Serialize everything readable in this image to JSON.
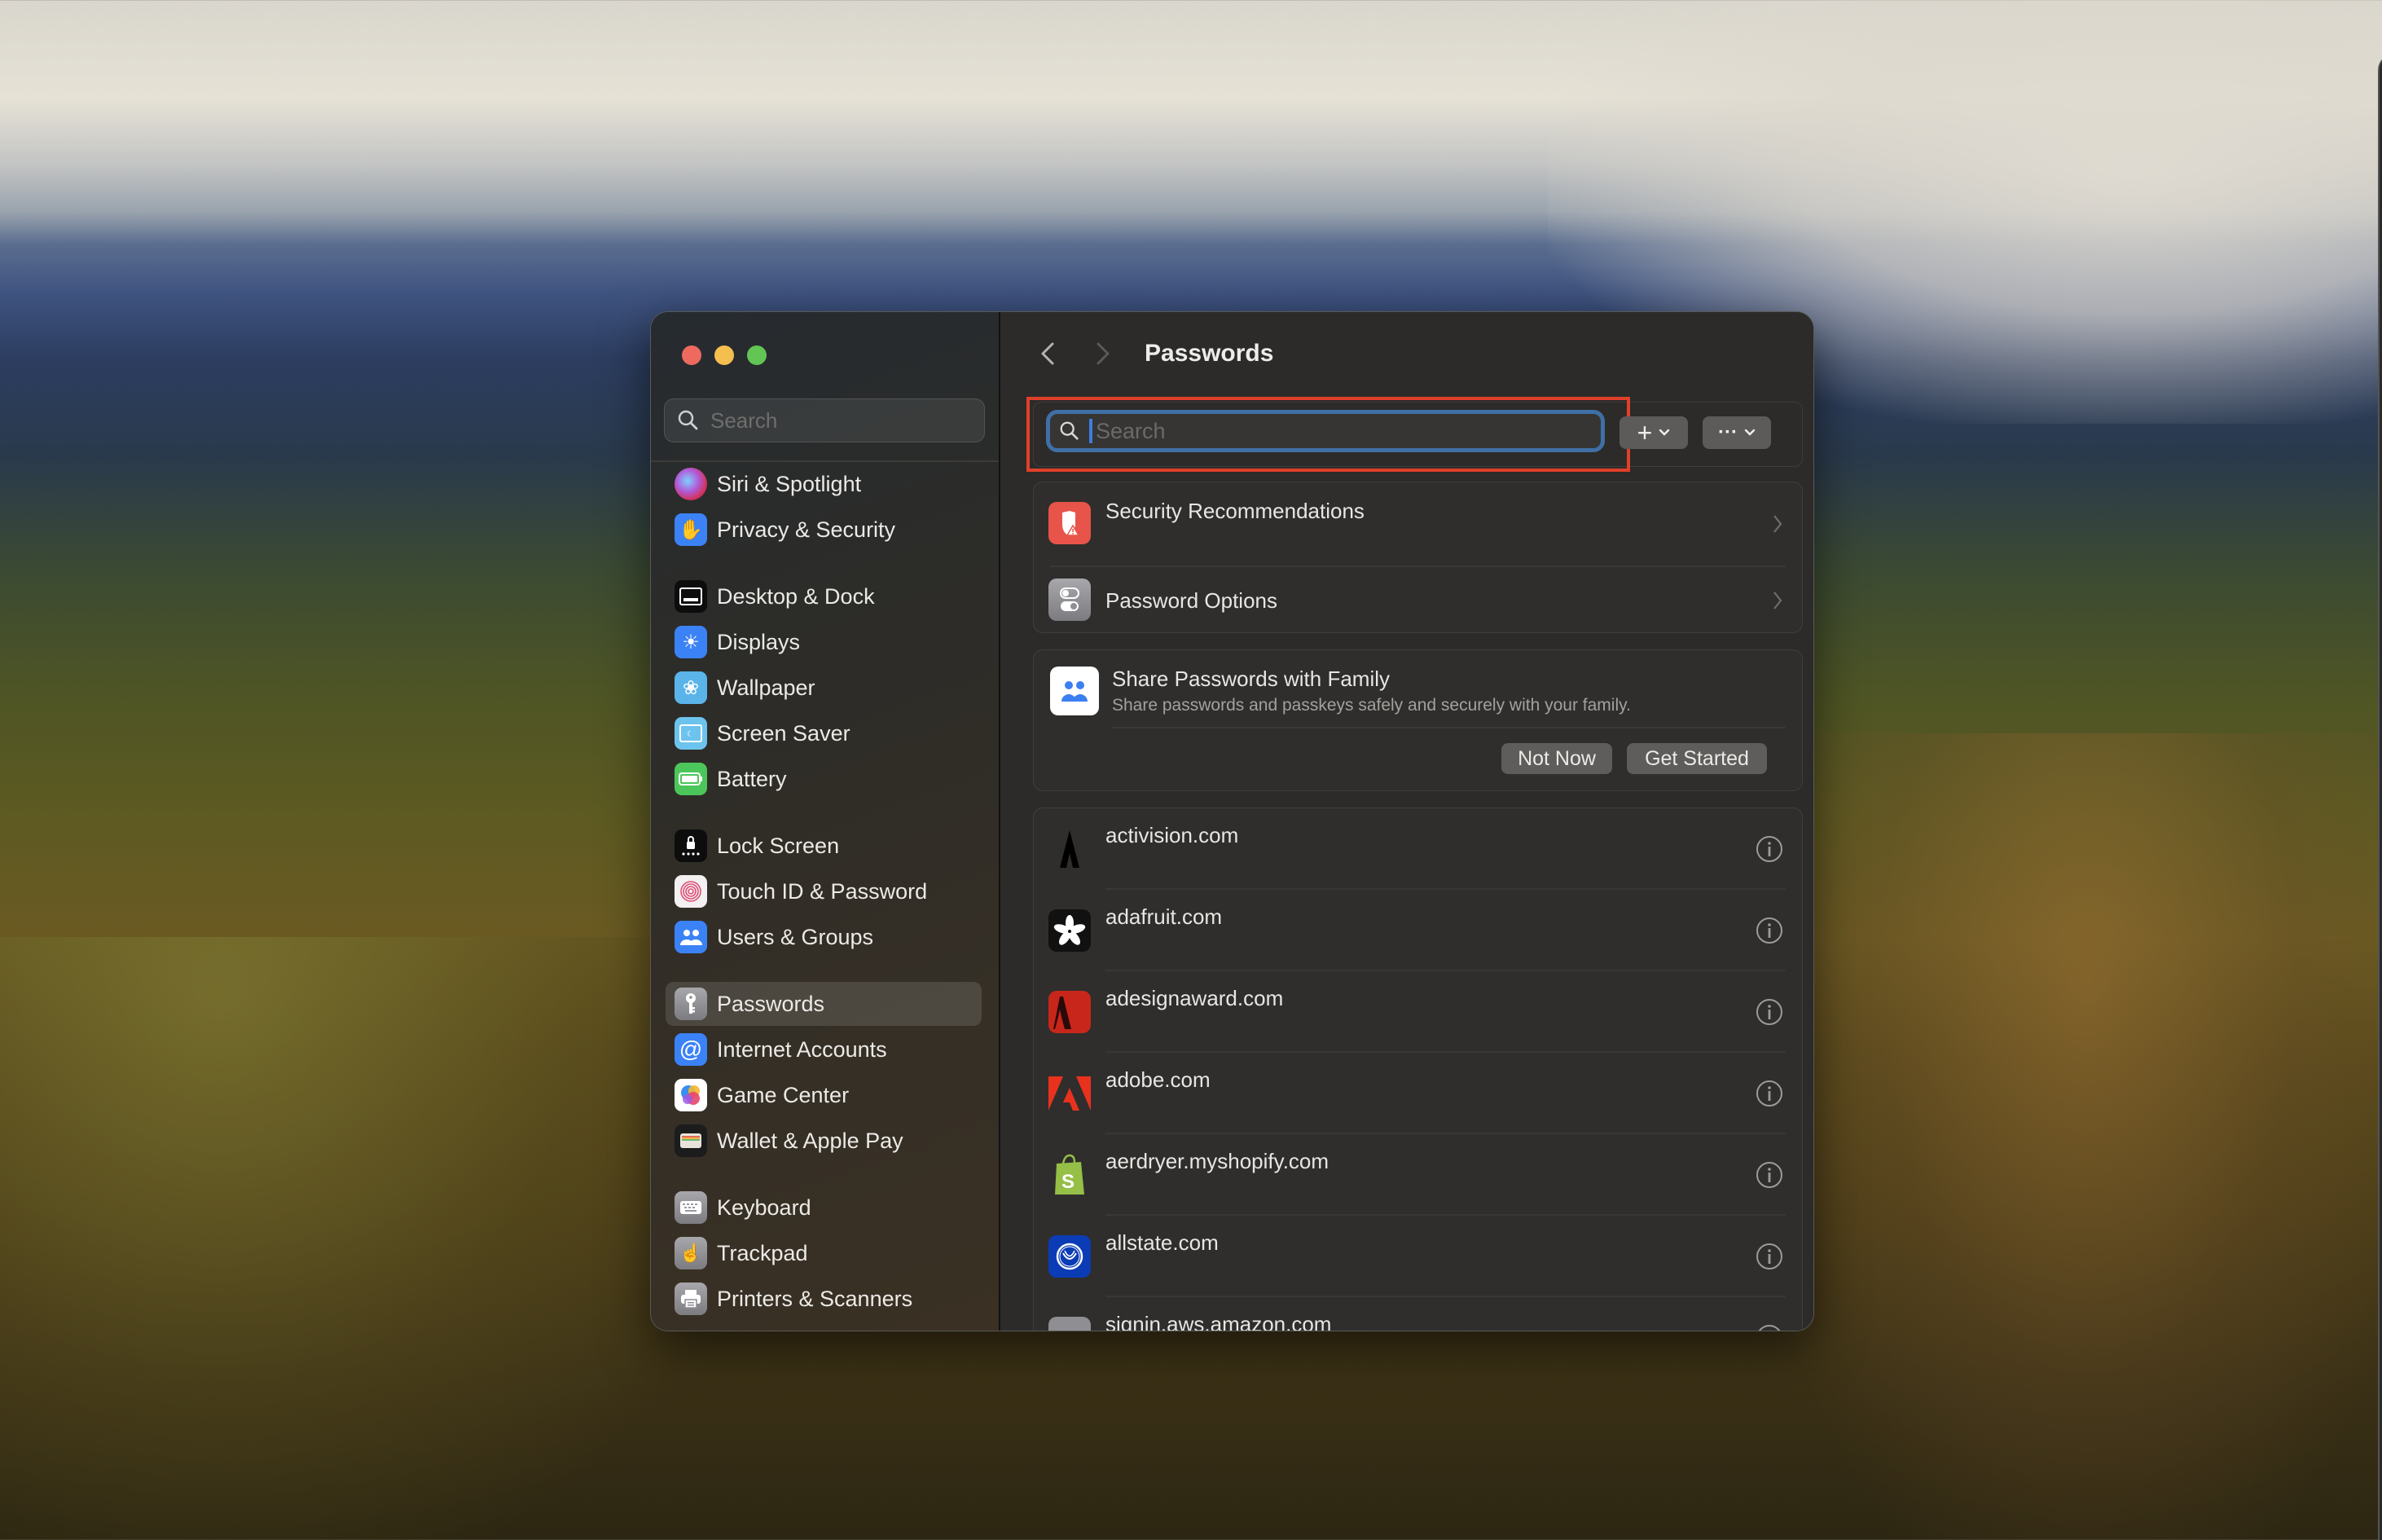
{
  "window": {
    "title": "Passwords",
    "traffic_lights": [
      "close",
      "minimize",
      "maximize"
    ]
  },
  "sidebar": {
    "search_placeholder": "Search",
    "items": [
      {
        "label": "Siri & Spotlight",
        "icon": "siri-icon",
        "color": "#8a3aa0"
      },
      {
        "label": "Privacy & Security",
        "icon": "hand-icon",
        "color": "#3b82f6"
      },
      {
        "label": "Desktop & Dock",
        "icon": "dock-icon",
        "color": "#111111"
      },
      {
        "label": "Displays",
        "icon": "sun-icon",
        "color": "#3b82f6"
      },
      {
        "label": "Wallpaper",
        "icon": "flower-icon",
        "color": "#5ab4ea"
      },
      {
        "label": "Screen Saver",
        "icon": "screensaver-icon",
        "color": "#6cc3ee"
      },
      {
        "label": "Battery",
        "icon": "battery-icon",
        "color": "#4cc65a"
      },
      {
        "label": "Lock Screen",
        "icon": "lock-icon",
        "color": "#111111"
      },
      {
        "label": "Touch ID & Password",
        "icon": "fingerprint-icon",
        "color": "#f2f0f0"
      },
      {
        "label": "Users & Groups",
        "icon": "users-icon",
        "color": "#3b82f6"
      },
      {
        "label": "Passwords",
        "icon": "key-icon",
        "color": "#8e8e93",
        "selected": true
      },
      {
        "label": "Internet Accounts",
        "icon": "at-icon",
        "color": "#3b82f6"
      },
      {
        "label": "Game Center",
        "icon": "game-center-icon",
        "color": "#ffffff"
      },
      {
        "label": "Wallet & Apple Pay",
        "icon": "wallet-icon",
        "color": "#1c1c1c"
      },
      {
        "label": "Keyboard",
        "icon": "keyboard-icon",
        "color": "#8e8e93"
      },
      {
        "label": "Trackpad",
        "icon": "trackpad-icon",
        "color": "#8e8e93"
      },
      {
        "label": "Printers & Scanners",
        "icon": "printer-icon",
        "color": "#8e8e93"
      }
    ]
  },
  "main": {
    "nav": {
      "back": "back-icon",
      "forward": "forward-icon"
    },
    "title": "Passwords",
    "search": {
      "placeholder": "Search",
      "value": ""
    },
    "toolbar": {
      "add_label": "+",
      "more_label": "···"
    },
    "settings_rows": [
      {
        "label": "Security Recommendations",
        "icon": "shield-warning-icon",
        "color": "#e8544a"
      },
      {
        "label": "Password Options",
        "icon": "toggles-icon",
        "color": "#8e8e93"
      }
    ],
    "share_card": {
      "title": "Share Passwords with Family",
      "subtitle": "Share passwords and passkeys safely and securely with your family.",
      "not_now_label": "Not Now",
      "get_started_label": "Get Started"
    },
    "accounts": [
      {
        "site": "activision.com",
        "icon": "activision-icon"
      },
      {
        "site": "adafruit.com",
        "icon": "adafruit-icon"
      },
      {
        "site": "adesignaward.com",
        "icon": "adesignaward-icon"
      },
      {
        "site": "adobe.com",
        "icon": "adobe-icon"
      },
      {
        "site": "aerdryer.myshopify.com",
        "icon": "shopify-icon"
      },
      {
        "site": "allstate.com",
        "icon": "allstate-icon"
      },
      {
        "site": "signin.aws.amazon.com",
        "icon": "aws-icon"
      }
    ]
  },
  "colors": {
    "accent": "#3f6fa5",
    "highlight": "#e0402a",
    "window_bg": "#2c2b29"
  }
}
